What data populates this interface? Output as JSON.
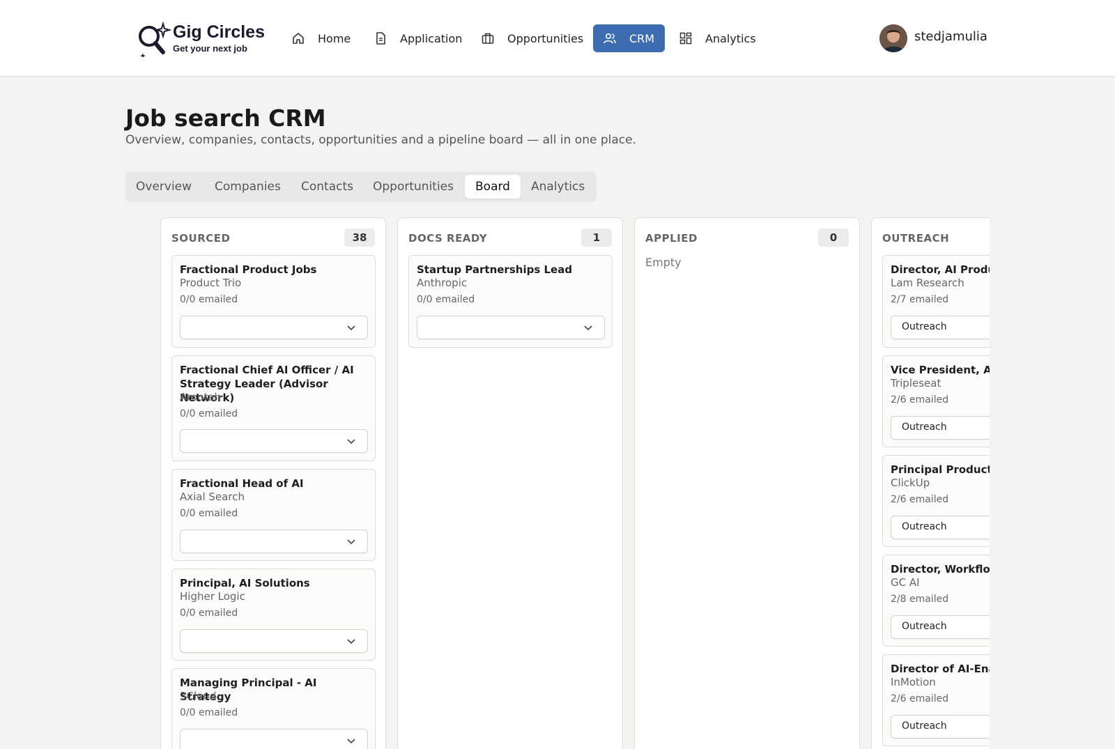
{
  "app": {
    "title": "Gig Circles",
    "subtitle": "Get your next job",
    "username": "stedjamulia"
  },
  "nav": [
    {
      "label": "Home",
      "icon": "home-icon"
    },
    {
      "label": "Application",
      "icon": "document-icon"
    },
    {
      "label": "Opportunities",
      "icon": "briefcase-icon"
    },
    {
      "label": "CRM",
      "icon": "users-icon",
      "active": true
    },
    {
      "label": "Analytics",
      "icon": "grid-icon"
    }
  ],
  "page": {
    "title": "Job search CRM",
    "subtitle": "Overview, companies, contacts, opportunities and a pipeline board — all in one place."
  },
  "tabs": [
    {
      "label": "Overview"
    },
    {
      "label": "Companies"
    },
    {
      "label": "Contacts"
    },
    {
      "label": "Opportunities"
    },
    {
      "label": "Board",
      "active": true
    },
    {
      "label": "Analytics"
    }
  ],
  "board": {
    "columns": [
      {
        "title": "SOURCED",
        "count": "38",
        "cards": [
          {
            "title": "Fractional Product Jobs",
            "company": "Product Trio",
            "emailed": "0/0 emailed",
            "status": ""
          },
          {
            "title": "Fractional Chief AI Officer / AI Strategy Leader (Advisor Network)",
            "company": "Arootah",
            "emailed": "0/0 emailed",
            "status": ""
          },
          {
            "title": "Fractional Head of AI",
            "company": "Axial Search",
            "emailed": "0/0 emailed",
            "status": ""
          },
          {
            "title": "Principal, AI Solutions",
            "company": "Higher Logic",
            "emailed": "0/0 emailed",
            "status": ""
          },
          {
            "title": "Managing Principal - AI Strategy",
            "company": "3Cloud",
            "emailed": "0/0 emailed",
            "status": ""
          }
        ]
      },
      {
        "title": "DOCS READY",
        "count": "1",
        "cards": [
          {
            "title": "Startup Partnerships Lead",
            "company": "Anthropic",
            "emailed": "0/0 emailed",
            "status": ""
          }
        ]
      },
      {
        "title": "APPLIED",
        "count": "0",
        "empty_text": "Empty",
        "cards": []
      },
      {
        "title": "OUTREACH",
        "cards": [
          {
            "title": "Director, AI Product",
            "company": "Lam Research",
            "emailed": "2/7 emailed",
            "status": "Outreach"
          },
          {
            "title": "Vice President, AI Pr",
            "company": "Tripleseat",
            "emailed": "2/6 emailed",
            "status": "Outreach"
          },
          {
            "title": "Principal Product M",
            "company": "ClickUp",
            "emailed": "2/6 emailed",
            "status": "Outreach"
          },
          {
            "title": "Director, Workflow S",
            "company": "GC AI",
            "emailed": "2/8 emailed",
            "status": "Outreach"
          },
          {
            "title": "Director of AI-Enabl",
            "company": "InMotion",
            "emailed": "2/6 emailed",
            "status": "Outreach"
          }
        ]
      }
    ]
  },
  "colors": {
    "accent": "#3d6db0",
    "background": "#f4f3f1",
    "card": "#fbfbfa",
    "border": "#dedcd8"
  }
}
